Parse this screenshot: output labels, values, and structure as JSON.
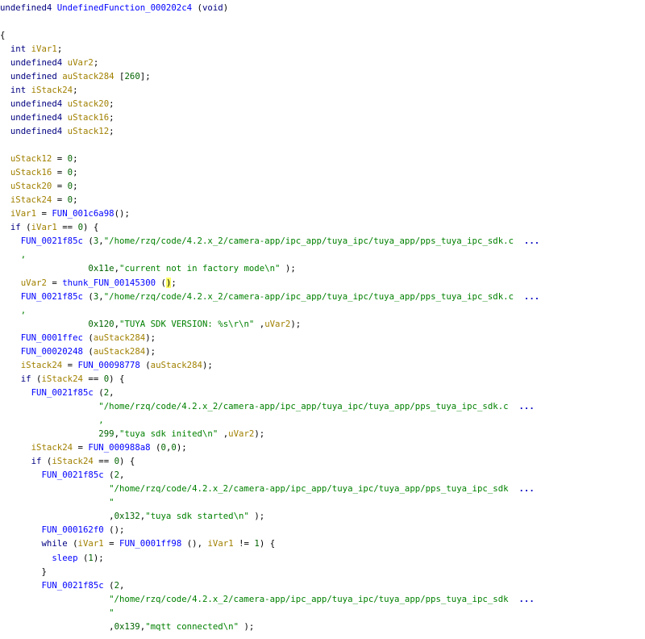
{
  "decompiler": {
    "colors": {
      "keyword": "#000080",
      "function": "#0000ff",
      "variable": "#a08000",
      "number": "#006400",
      "string": "#008000",
      "cursor_highlight": "#ffff66",
      "background": "#ffffff"
    },
    "lines": [
      [
        {
          "t": "kw",
          "v": "undefined4 "
        },
        {
          "t": "fn",
          "v": "UndefinedFunction_000202c4"
        },
        {
          "t": "punct",
          "v": " ("
        },
        {
          "t": "kw",
          "v": "void"
        },
        {
          "t": "punct",
          "v": ")"
        }
      ],
      [],
      [
        {
          "t": "punct",
          "v": "{"
        }
      ],
      [
        {
          "t": "punct",
          "v": "  "
        },
        {
          "t": "kw",
          "v": "int "
        },
        {
          "t": "var",
          "v": "iVar1"
        },
        {
          "t": "punct",
          "v": ";"
        }
      ],
      [
        {
          "t": "punct",
          "v": "  "
        },
        {
          "t": "kw",
          "v": "undefined4 "
        },
        {
          "t": "var",
          "v": "uVar2"
        },
        {
          "t": "punct",
          "v": ";"
        }
      ],
      [
        {
          "t": "punct",
          "v": "  "
        },
        {
          "t": "kw",
          "v": "undefined "
        },
        {
          "t": "var",
          "v": "auStack284"
        },
        {
          "t": "punct",
          "v": " ["
        },
        {
          "t": "num",
          "v": "260"
        },
        {
          "t": "punct",
          "v": "];"
        }
      ],
      [
        {
          "t": "punct",
          "v": "  "
        },
        {
          "t": "kw",
          "v": "int "
        },
        {
          "t": "var",
          "v": "iStack24"
        },
        {
          "t": "punct",
          "v": ";"
        }
      ],
      [
        {
          "t": "punct",
          "v": "  "
        },
        {
          "t": "kw",
          "v": "undefined4 "
        },
        {
          "t": "var",
          "v": "uStack20"
        },
        {
          "t": "punct",
          "v": ";"
        }
      ],
      [
        {
          "t": "punct",
          "v": "  "
        },
        {
          "t": "kw",
          "v": "undefined4 "
        },
        {
          "t": "var",
          "v": "uStack16"
        },
        {
          "t": "punct",
          "v": ";"
        }
      ],
      [
        {
          "t": "punct",
          "v": "  "
        },
        {
          "t": "kw",
          "v": "undefined4 "
        },
        {
          "t": "var",
          "v": "uStack12"
        },
        {
          "t": "punct",
          "v": ";"
        }
      ],
      [],
      [
        {
          "t": "punct",
          "v": "  "
        },
        {
          "t": "var",
          "v": "uStack12"
        },
        {
          "t": "punct",
          "v": " = "
        },
        {
          "t": "num",
          "v": "0"
        },
        {
          "t": "punct",
          "v": ";"
        }
      ],
      [
        {
          "t": "punct",
          "v": "  "
        },
        {
          "t": "var",
          "v": "uStack16"
        },
        {
          "t": "punct",
          "v": " = "
        },
        {
          "t": "num",
          "v": "0"
        },
        {
          "t": "punct",
          "v": ";"
        }
      ],
      [
        {
          "t": "punct",
          "v": "  "
        },
        {
          "t": "var",
          "v": "uStack20"
        },
        {
          "t": "punct",
          "v": " = "
        },
        {
          "t": "num",
          "v": "0"
        },
        {
          "t": "punct",
          "v": ";"
        }
      ],
      [
        {
          "t": "punct",
          "v": "  "
        },
        {
          "t": "var",
          "v": "iStack24"
        },
        {
          "t": "punct",
          "v": " = "
        },
        {
          "t": "num",
          "v": "0"
        },
        {
          "t": "punct",
          "v": ";"
        }
      ],
      [
        {
          "t": "punct",
          "v": "  "
        },
        {
          "t": "var",
          "v": "iVar1"
        },
        {
          "t": "punct",
          "v": " = "
        },
        {
          "t": "fn",
          "v": "FUN_001c6a98"
        },
        {
          "t": "punct",
          "v": "();"
        }
      ],
      [
        {
          "t": "punct",
          "v": "  "
        },
        {
          "t": "kw",
          "v": "if"
        },
        {
          "t": "punct",
          "v": " ("
        },
        {
          "t": "var",
          "v": "iVar1"
        },
        {
          "t": "punct",
          "v": " == "
        },
        {
          "t": "num",
          "v": "0"
        },
        {
          "t": "punct",
          "v": ") {"
        }
      ],
      [
        {
          "t": "punct",
          "v": "    "
        },
        {
          "t": "fn",
          "v": "FUN_0021f85c"
        },
        {
          "t": "punct",
          "v": " ("
        },
        {
          "t": "num",
          "v": "3"
        },
        {
          "t": "punct",
          "v": ","
        },
        {
          "t": "str",
          "v": "\"/home/rzq/code/4.2.x_2/camera-app/ipc_app/tuya_ipc/tuya_app/pps_tuya_ipc_sdk.c"
        },
        {
          "t": "punct",
          "v": "  "
        },
        {
          "t": "ellipsis",
          "v": "..."
        }
      ],
      [
        {
          "t": "punct",
          "v": "    "
        },
        {
          "t": "str",
          "v": ","
        }
      ],
      [
        {
          "t": "punct",
          "v": "                 "
        },
        {
          "t": "num",
          "v": "0x11e"
        },
        {
          "t": "punct",
          "v": ","
        },
        {
          "t": "str",
          "v": "\"current not in factory mode\\n\""
        },
        {
          "t": "punct",
          "v": " );"
        }
      ],
      [
        {
          "t": "punct",
          "v": "    "
        },
        {
          "t": "var",
          "v": "uVar2"
        },
        {
          "t": "punct",
          "v": " = "
        },
        {
          "t": "fn",
          "v": "thunk_FUN_00145300"
        },
        {
          "t": "punct",
          "v": " ("
        },
        {
          "t": "cursor",
          "v": ")"
        },
        {
          "t": "punct",
          "v": ";"
        }
      ],
      [
        {
          "t": "punct",
          "v": "    "
        },
        {
          "t": "fn",
          "v": "FUN_0021f85c"
        },
        {
          "t": "punct",
          "v": " ("
        },
        {
          "t": "num",
          "v": "3"
        },
        {
          "t": "punct",
          "v": ","
        },
        {
          "t": "str",
          "v": "\"/home/rzq/code/4.2.x_2/camera-app/ipc_app/tuya_ipc/tuya_app/pps_tuya_ipc_sdk.c"
        },
        {
          "t": "punct",
          "v": "  "
        },
        {
          "t": "ellipsis",
          "v": "..."
        }
      ],
      [
        {
          "t": "punct",
          "v": "    "
        },
        {
          "t": "str",
          "v": ","
        }
      ],
      [
        {
          "t": "punct",
          "v": "                 "
        },
        {
          "t": "num",
          "v": "0x120"
        },
        {
          "t": "punct",
          "v": ","
        },
        {
          "t": "str",
          "v": "\"TUYA SDK VERSION: %s\\r\\n\""
        },
        {
          "t": "punct",
          "v": " ,"
        },
        {
          "t": "var",
          "v": "uVar2"
        },
        {
          "t": "punct",
          "v": ");"
        }
      ],
      [
        {
          "t": "punct",
          "v": "    "
        },
        {
          "t": "fn",
          "v": "FUN_0001ffec"
        },
        {
          "t": "punct",
          "v": " ("
        },
        {
          "t": "var",
          "v": "auStack284"
        },
        {
          "t": "punct",
          "v": ");"
        }
      ],
      [
        {
          "t": "punct",
          "v": "    "
        },
        {
          "t": "fn",
          "v": "FUN_00020248"
        },
        {
          "t": "punct",
          "v": " ("
        },
        {
          "t": "var",
          "v": "auStack284"
        },
        {
          "t": "punct",
          "v": ");"
        }
      ],
      [
        {
          "t": "punct",
          "v": "    "
        },
        {
          "t": "var",
          "v": "iStack24"
        },
        {
          "t": "punct",
          "v": " = "
        },
        {
          "t": "fn",
          "v": "FUN_00098778"
        },
        {
          "t": "punct",
          "v": " ("
        },
        {
          "t": "var",
          "v": "auStack284"
        },
        {
          "t": "punct",
          "v": ");"
        }
      ],
      [
        {
          "t": "punct",
          "v": "    "
        },
        {
          "t": "kw",
          "v": "if"
        },
        {
          "t": "punct",
          "v": " ("
        },
        {
          "t": "var",
          "v": "iStack24"
        },
        {
          "t": "punct",
          "v": " == "
        },
        {
          "t": "num",
          "v": "0"
        },
        {
          "t": "punct",
          "v": ") {"
        }
      ],
      [
        {
          "t": "punct",
          "v": "      "
        },
        {
          "t": "fn",
          "v": "FUN_0021f85c"
        },
        {
          "t": "punct",
          "v": " ("
        },
        {
          "t": "num",
          "v": "2"
        },
        {
          "t": "punct",
          "v": ","
        }
      ],
      [
        {
          "t": "punct",
          "v": "                   "
        },
        {
          "t": "str",
          "v": "\"/home/rzq/code/4.2.x_2/camera-app/ipc_app/tuya_ipc/tuya_app/pps_tuya_ipc_sdk.c"
        },
        {
          "t": "punct",
          "v": "  "
        },
        {
          "t": "ellipsis",
          "v": "..."
        }
      ],
      [
        {
          "t": "punct",
          "v": "                   "
        },
        {
          "t": "str",
          "v": ","
        }
      ],
      [
        {
          "t": "punct",
          "v": "                   "
        },
        {
          "t": "num",
          "v": "299"
        },
        {
          "t": "punct",
          "v": ","
        },
        {
          "t": "str",
          "v": "\"tuya sdk inited\\n\""
        },
        {
          "t": "punct",
          "v": " ,"
        },
        {
          "t": "var",
          "v": "uVar2"
        },
        {
          "t": "punct",
          "v": ");"
        }
      ],
      [
        {
          "t": "punct",
          "v": "      "
        },
        {
          "t": "var",
          "v": "iStack24"
        },
        {
          "t": "punct",
          "v": " = "
        },
        {
          "t": "fn",
          "v": "FUN_000988a8"
        },
        {
          "t": "punct",
          "v": " ("
        },
        {
          "t": "num",
          "v": "0"
        },
        {
          "t": "punct",
          "v": ","
        },
        {
          "t": "num",
          "v": "0"
        },
        {
          "t": "punct",
          "v": ");"
        }
      ],
      [
        {
          "t": "punct",
          "v": "      "
        },
        {
          "t": "kw",
          "v": "if"
        },
        {
          "t": "punct",
          "v": " ("
        },
        {
          "t": "var",
          "v": "iStack24"
        },
        {
          "t": "punct",
          "v": " == "
        },
        {
          "t": "num",
          "v": "0"
        },
        {
          "t": "punct",
          "v": ") {"
        }
      ],
      [
        {
          "t": "punct",
          "v": "        "
        },
        {
          "t": "fn",
          "v": "FUN_0021f85c"
        },
        {
          "t": "punct",
          "v": " ("
        },
        {
          "t": "num",
          "v": "2"
        },
        {
          "t": "punct",
          "v": ","
        }
      ],
      [
        {
          "t": "punct",
          "v": "                     "
        },
        {
          "t": "str",
          "v": "\"/home/rzq/code/4.2.x_2/camera-app/ipc_app/tuya_ipc/tuya_app/pps_tuya_ipc_sdk"
        },
        {
          "t": "punct",
          "v": "  "
        },
        {
          "t": "ellipsis",
          "v": "..."
        }
      ],
      [
        {
          "t": "punct",
          "v": "                     "
        },
        {
          "t": "str",
          "v": "\""
        }
      ],
      [
        {
          "t": "punct",
          "v": "                     "
        },
        {
          "t": "punct",
          "v": ","
        },
        {
          "t": "num",
          "v": "0x132"
        },
        {
          "t": "punct",
          "v": ","
        },
        {
          "t": "str",
          "v": "\"tuya sdk started\\n\""
        },
        {
          "t": "punct",
          "v": " );"
        }
      ],
      [
        {
          "t": "punct",
          "v": "        "
        },
        {
          "t": "fn",
          "v": "FUN_000162f0"
        },
        {
          "t": "punct",
          "v": " ();"
        }
      ],
      [
        {
          "t": "punct",
          "v": "        "
        },
        {
          "t": "kw",
          "v": "while"
        },
        {
          "t": "punct",
          "v": " ("
        },
        {
          "t": "var",
          "v": "iVar1"
        },
        {
          "t": "punct",
          "v": " = "
        },
        {
          "t": "fn",
          "v": "FUN_0001ff98"
        },
        {
          "t": "punct",
          "v": " (), "
        },
        {
          "t": "var",
          "v": "iVar1"
        },
        {
          "t": "punct",
          "v": " != "
        },
        {
          "t": "num",
          "v": "1"
        },
        {
          "t": "punct",
          "v": ") {"
        }
      ],
      [
        {
          "t": "punct",
          "v": "          "
        },
        {
          "t": "fn",
          "v": "sleep"
        },
        {
          "t": "punct",
          "v": " ("
        },
        {
          "t": "num",
          "v": "1"
        },
        {
          "t": "punct",
          "v": ");"
        }
      ],
      [
        {
          "t": "punct",
          "v": "        }"
        }
      ],
      [
        {
          "t": "punct",
          "v": "        "
        },
        {
          "t": "fn",
          "v": "FUN_0021f85c"
        },
        {
          "t": "punct",
          "v": " ("
        },
        {
          "t": "num",
          "v": "2"
        },
        {
          "t": "punct",
          "v": ","
        }
      ],
      [
        {
          "t": "punct",
          "v": "                     "
        },
        {
          "t": "str",
          "v": "\"/home/rzq/code/4.2.x_2/camera-app/ipc_app/tuya_ipc/tuya_app/pps_tuya_ipc_sdk"
        },
        {
          "t": "punct",
          "v": "  "
        },
        {
          "t": "ellipsis",
          "v": "..."
        }
      ],
      [
        {
          "t": "punct",
          "v": "                     "
        },
        {
          "t": "str",
          "v": "\""
        }
      ],
      [
        {
          "t": "punct",
          "v": "                     "
        },
        {
          "t": "punct",
          "v": ","
        },
        {
          "t": "num",
          "v": "0x139"
        },
        {
          "t": "punct",
          "v": ","
        },
        {
          "t": "str",
          "v": "\"mqtt connected\\n\""
        },
        {
          "t": "punct",
          "v": " );"
        }
      ]
    ]
  }
}
